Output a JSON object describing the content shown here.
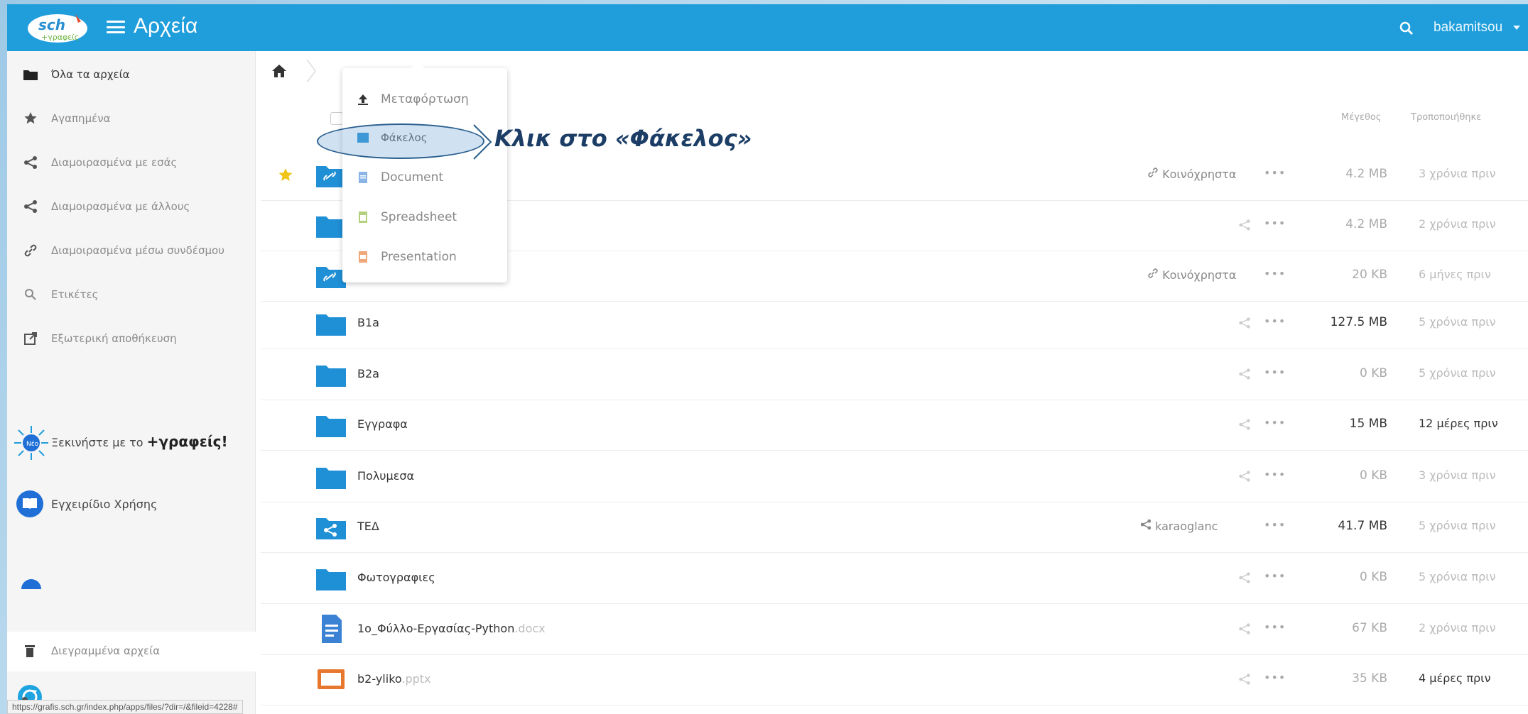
{
  "header": {
    "app_title": "Αρχεία",
    "user": "bakamitsou"
  },
  "sidebar": {
    "items": [
      {
        "label": "Όλα τα αρχεία",
        "icon": "folder-icon"
      },
      {
        "label": "Αγαπημένα",
        "icon": "star-icon"
      },
      {
        "label": "Διαμοιρασμένα με εσάς",
        "icon": "share-icon"
      },
      {
        "label": "Διαμοιρασμένα με άλλους",
        "icon": "share-icon"
      },
      {
        "label": "Διαμοιρασμένα μέσω συνδέσμου",
        "icon": "link-icon"
      },
      {
        "label": "Ετικέτες",
        "icon": "tag-icon"
      },
      {
        "label": "Εξωτερική αποθήκευση",
        "icon": "external-storage-icon"
      }
    ],
    "promo_text": "Ξεκινήστε με το",
    "promo_brand": "+γραφείς!",
    "manual": "Εγχειρίδιο Χρήσης",
    "trash": "Διεγραμμένα αρχεία"
  },
  "columns": {
    "size": "Μέγεθος",
    "modified": "Τροποποιήθηκε"
  },
  "dropdown": {
    "items": [
      "Μεταφόρτωση",
      "Φάκελος",
      "Document",
      "Spreadsheet",
      "Presentation"
    ]
  },
  "callout": "Κλικ στο «Φάκελος»",
  "files": [
    {
      "name": "",
      "ext": "",
      "shared": "Κοινόχρηστα",
      "size": "4.2 MB",
      "modified": "3 χρόνια πριν"
    },
    {
      "name": "",
      "ext": "",
      "shared": "",
      "size": "4.2 MB",
      "modified": "2 χρόνια πριν"
    },
    {
      "name": "",
      "ext": "",
      "shared": "Κοινόχρηστα",
      "size": "20 KB",
      "modified": "6 μήνες πριν"
    },
    {
      "name": "B1a",
      "ext": "",
      "shared": "",
      "size": "127.5 MB",
      "modified": "5 χρόνια πριν"
    },
    {
      "name": "B2a",
      "ext": "",
      "shared": "",
      "size": "0 KB",
      "modified": "5 χρόνια πριν"
    },
    {
      "name": "Εγγραφα",
      "ext": "",
      "shared": "",
      "size": "15 MB",
      "modified": "12 μέρες πριν"
    },
    {
      "name": "Πολυμεσα",
      "ext": "",
      "shared": "",
      "size": "0 KB",
      "modified": "3 χρόνια πριν"
    },
    {
      "name": "ΤΕΔ",
      "ext": "",
      "shared": "karaoglanc",
      "size": "41.7 MB",
      "modified": "5 χρόνια πριν"
    },
    {
      "name": "Φωτογραφιες",
      "ext": "",
      "shared": "",
      "size": "0 KB",
      "modified": "5 χρόνια πριν"
    },
    {
      "name": "1o_Φύλλο-Εργασίας-Python",
      "ext": ".docx",
      "shared": "",
      "size": "67 KB",
      "modified": "2 χρόνια πριν"
    },
    {
      "name": "b2-yliko",
      "ext": ".pptx",
      "shared": "",
      "size": "35 KB",
      "modified": "4 μέρες πριν"
    }
  ],
  "status_url": "https://grafis.sch.gr/index.php/apps/files/?dir=/&fileid=4228#",
  "colors": {
    "header": "#1f9edb",
    "folder": "#1f8fd6",
    "callout": "#1c3e66"
  }
}
